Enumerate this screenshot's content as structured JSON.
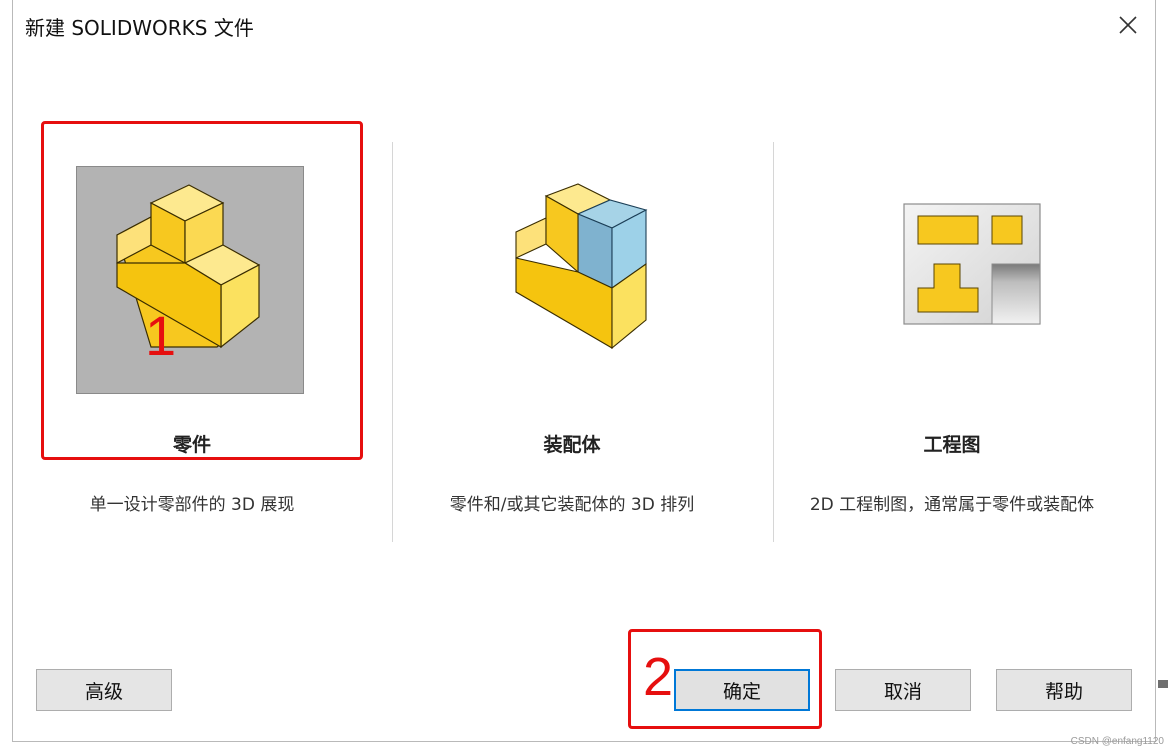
{
  "dialog": {
    "title": "新建 SOLIDWORKS 文件"
  },
  "options": [
    {
      "label": "零件",
      "description": "单一设计零部件的 3D 展现",
      "icon": "part-icon"
    },
    {
      "label": "装配体",
      "description": "零件和/或其它装配体的 3D 排列",
      "icon": "assembly-icon"
    },
    {
      "label": "工程图",
      "description": "2D 工程制图，通常属于零件或装配体",
      "icon": "drawing-icon"
    }
  ],
  "annotations": {
    "marker_1": "1",
    "marker_2": "2",
    "highlight_color": "#e60f0f"
  },
  "buttons": {
    "advanced": "高级",
    "ok": "确定",
    "cancel": "取消",
    "help": "帮助"
  },
  "watermark": "CSDN @enfang1120",
  "colors": {
    "part_yellow": "#f7c81f",
    "assembly_blue": "#84b9d6",
    "selected_bg": "#b3b3b3",
    "focus_blue": "#0078d7"
  }
}
